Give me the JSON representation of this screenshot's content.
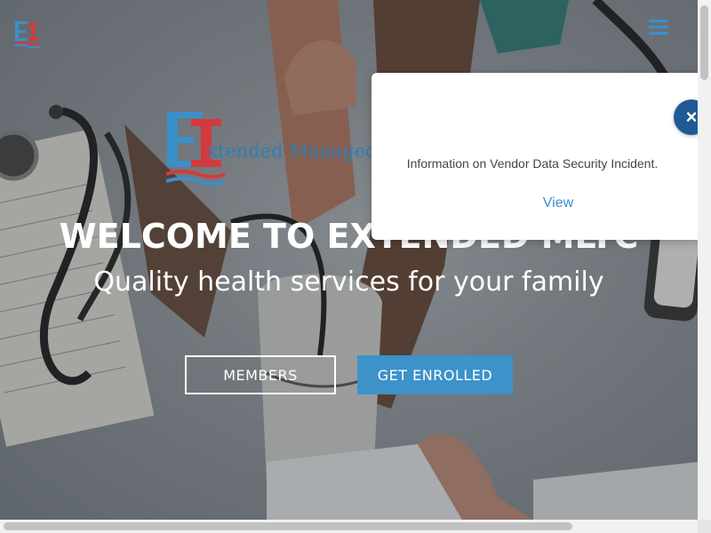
{
  "header": {
    "logo_icon": "ei-logo-icon",
    "menu_icon": "hamburger-menu-icon"
  },
  "hero": {
    "brand_text": "xtended Managed",
    "title": "WELCOME TO EXTENDED MLTC",
    "subtitle": "Quality health services for your family",
    "buttons": {
      "members": "MEMBERS",
      "enroll": "GET ENROLLED"
    }
  },
  "popup": {
    "message": "Information on Vendor Data Security Incident.",
    "link": "View",
    "close": "×"
  },
  "colors": {
    "accent": "#3d92c9",
    "logo_red": "#d33a3f",
    "close_button": "#1f5a96"
  }
}
